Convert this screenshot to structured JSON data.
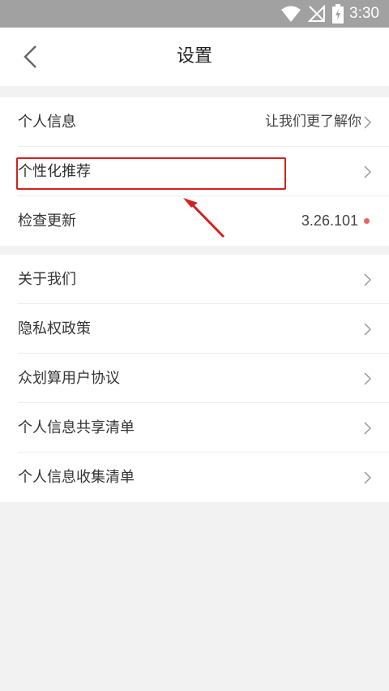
{
  "status_bar": {
    "time": "3:30"
  },
  "header": {
    "title": "设置"
  },
  "group1": [
    {
      "label": "个人信息",
      "value": "让我们更了解你"
    },
    {
      "label": "个性化推荐"
    },
    {
      "label": "检查更新",
      "value": "3.26.101"
    }
  ],
  "group2": [
    {
      "label": "关于我们"
    },
    {
      "label": "隐私权政策"
    },
    {
      "label": "众划算用户协议"
    },
    {
      "label": "个人信息共享清单"
    },
    {
      "label": "个人信息收集清单"
    }
  ],
  "colors": {
    "accent": "#d42020",
    "update_dot": "#f06262",
    "status_bar": "#a1a1a1"
  },
  "icons": [
    "wifi-icon",
    "signal-icon",
    "battery-icon",
    "back-icon",
    "chevron-right-icon",
    "update-dot"
  ]
}
